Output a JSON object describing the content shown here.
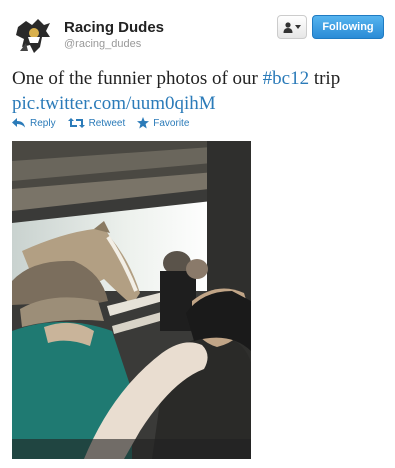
{
  "profile": {
    "display_name": "Racing Dudes",
    "handle": "@racing_dudes",
    "avatar_icon": "racing-dudes-logo"
  },
  "header_actions": {
    "user_menu_icon": "person-dropdown-icon",
    "follow_label": "Following"
  },
  "tweet": {
    "text_before": "One of the funnier photos of our ",
    "hashtag": "#bc12",
    "text_after": " trip",
    "link": "pic.twitter.com/uum0qihM"
  },
  "actions": {
    "reply": "Reply",
    "retweet": "Retweet",
    "favorite": "Favorite"
  },
  "colors": {
    "link": "#2b7bb9",
    "follow_button": "#2a8bd6"
  }
}
